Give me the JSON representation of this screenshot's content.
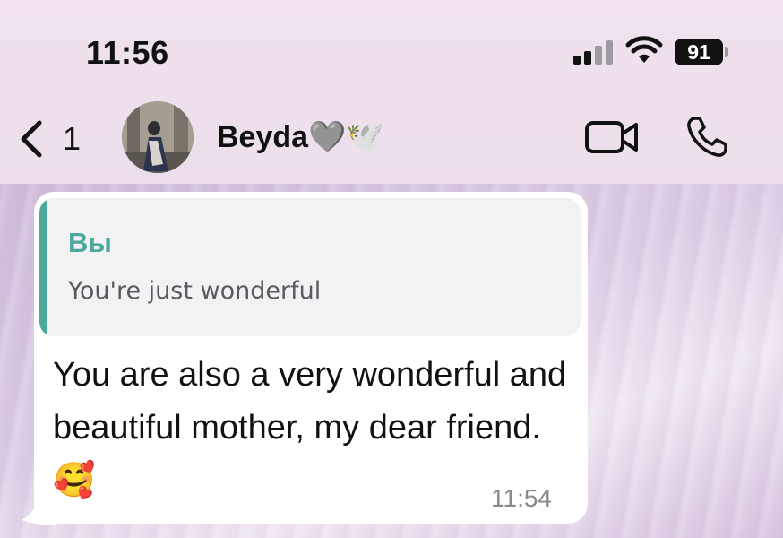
{
  "status_bar": {
    "time": "11:56",
    "battery": "91"
  },
  "header": {
    "back_count": "1",
    "contact_name": "Beyda🩶🕊️"
  },
  "message": {
    "quote_author": "Вы",
    "quote_text": "You're just wonderful",
    "text": "You are also a very wonderful and beautiful mother, my dear friend.🥰",
    "time": "11:54"
  },
  "colors": {
    "quote_accent": "#4ca89a",
    "bubble": "#ffffff",
    "header_bg": "#ecdfeb"
  },
  "icons": [
    "back-chevron-icon",
    "video-call-icon",
    "phone-call-icon",
    "signal-icon",
    "wifi-icon",
    "battery-icon"
  ]
}
